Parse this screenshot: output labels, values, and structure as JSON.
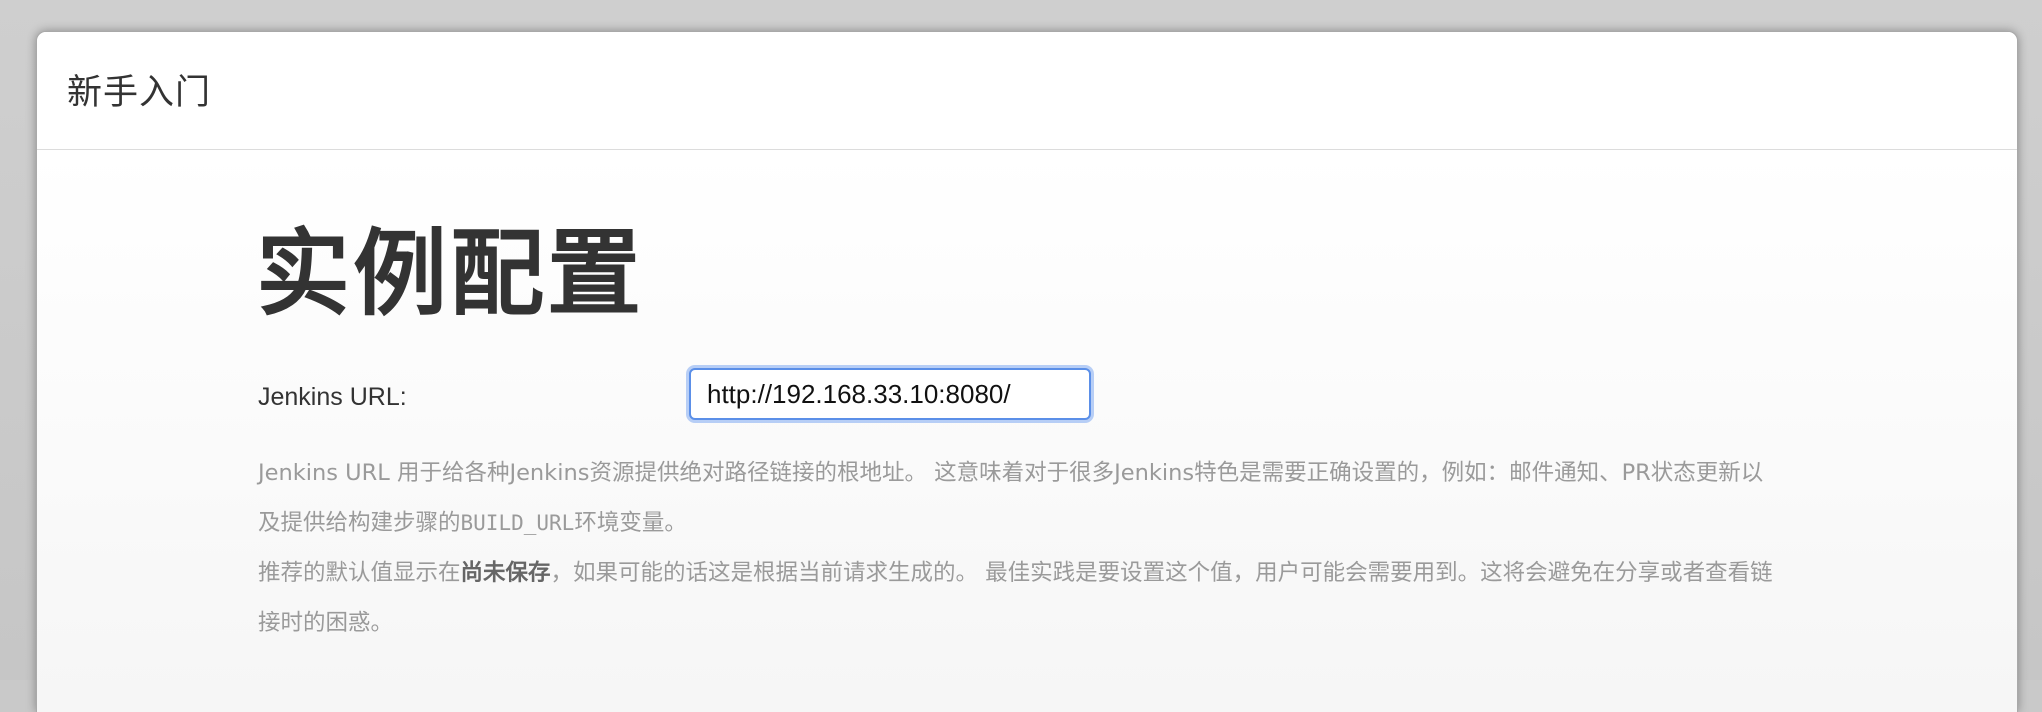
{
  "header": {
    "title": "新手入门"
  },
  "main": {
    "title": "实例配置",
    "url_field": {
      "label": "Jenkins URL:",
      "value": "http://192.168.33.10:8080/"
    },
    "help": {
      "p1_a": "Jenkins URL 用于给各种Jenkins资源提供绝对路径链接的根地址。 这意味着对于很多Jenkins特色是需要正确设置的，例如：邮件通知、PR状态更新以及提供给构建步骤的",
      "p1_code": "BUILD_URL",
      "p1_b": "环境变量。",
      "p2_a": "推荐的默认值显示在",
      "p2_strong": "尚未保存",
      "p2_b": "，如果可能的话这是根据当前请求生成的。 最佳实践是要设置这个值，用户可能会需要用到。这将会避免在分享或者查看链接时的困惑。"
    }
  }
}
